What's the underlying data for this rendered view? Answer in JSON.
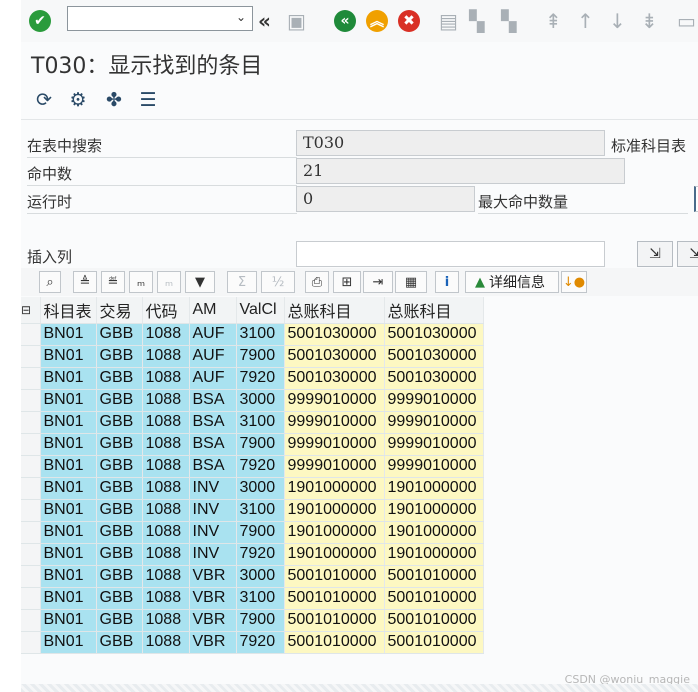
{
  "toolbar": {
    "command_value": "",
    "dropdown_arrow": "⌄"
  },
  "title": "T030：显示找到的条目",
  "search": {
    "label_table": "在表中搜索",
    "table_value": "T030",
    "table_desc": "标准科目表",
    "label_hits": "命中数",
    "hits_value": "21",
    "label_runtime": "运行时",
    "runtime_value": "0",
    "label_max_hits": "最大命中数量",
    "label_insert_col": "插入列",
    "insert_col_value": ""
  },
  "alv": {
    "details_label": "详细信息"
  },
  "table": {
    "headers": [
      "科目表",
      "交易",
      "代码",
      "AM",
      "ValCl",
      "总账科目",
      "总账科目"
    ],
    "rows": [
      [
        "BN01",
        "GBB",
        "1088",
        "AUF",
        "3100",
        "5001030000",
        "5001030000"
      ],
      [
        "BN01",
        "GBB",
        "1088",
        "AUF",
        "7900",
        "5001030000",
        "5001030000"
      ],
      [
        "BN01",
        "GBB",
        "1088",
        "AUF",
        "7920",
        "5001030000",
        "5001030000"
      ],
      [
        "BN01",
        "GBB",
        "1088",
        "BSA",
        "3000",
        "9999010000",
        "9999010000"
      ],
      [
        "BN01",
        "GBB",
        "1088",
        "BSA",
        "3100",
        "9999010000",
        "9999010000"
      ],
      [
        "BN01",
        "GBB",
        "1088",
        "BSA",
        "7900",
        "9999010000",
        "9999010000"
      ],
      [
        "BN01",
        "GBB",
        "1088",
        "BSA",
        "7920",
        "9999010000",
        "9999010000"
      ],
      [
        "BN01",
        "GBB",
        "1088",
        "INV",
        "3000",
        "1901000000",
        "1901000000"
      ],
      [
        "BN01",
        "GBB",
        "1088",
        "INV",
        "3100",
        "1901000000",
        "1901000000"
      ],
      [
        "BN01",
        "GBB",
        "1088",
        "INV",
        "7900",
        "1901000000",
        "1901000000"
      ],
      [
        "BN01",
        "GBB",
        "1088",
        "INV",
        "7920",
        "1901000000",
        "1901000000"
      ],
      [
        "BN01",
        "GBB",
        "1088",
        "VBR",
        "3000",
        "5001010000",
        "5001010000"
      ],
      [
        "BN01",
        "GBB",
        "1088",
        "VBR",
        "3100",
        "5001010000",
        "5001010000"
      ],
      [
        "BN01",
        "GBB",
        "1088",
        "VBR",
        "7900",
        "5001010000",
        "5001010000"
      ],
      [
        "BN01",
        "GBB",
        "1088",
        "VBR",
        "7920",
        "5001010000",
        "5001010000"
      ]
    ]
  },
  "watermark": "CSDN @woniu_maggie",
  "colors": {
    "key_col": "#a9e2f0",
    "value_col": "#fdf8c2",
    "ok_green": "#2a9b3c",
    "back_green": "#1f8a3a",
    "exit_orange": "#f0a000",
    "cancel_red": "#d93025"
  }
}
